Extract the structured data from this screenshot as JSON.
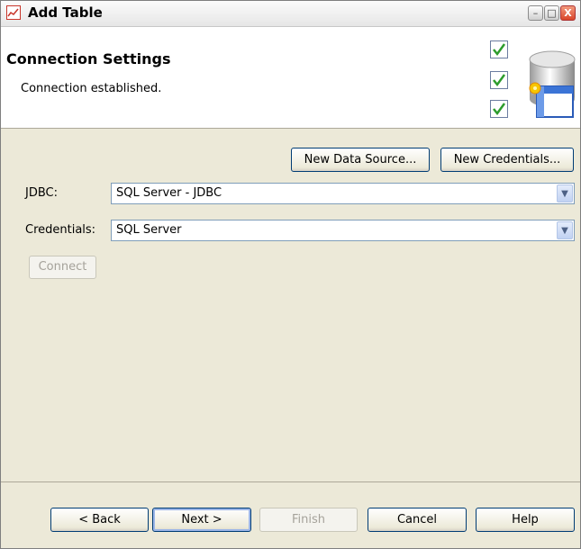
{
  "window": {
    "title": "Add Table",
    "controls": {
      "minimize": "–",
      "maximize": "□",
      "close": "X"
    }
  },
  "header": {
    "title": "Connection Settings",
    "subtitle": "Connection established."
  },
  "toolbar": {
    "new_data_source": "New Data Source...",
    "new_credentials": "New Credentials..."
  },
  "form": {
    "jdbc_label": "JDBC:",
    "jdbc_value": "SQL Server - JDBC",
    "credentials_label": "Credentials:",
    "credentials_value": "SQL Server",
    "connect_label": "Connect"
  },
  "footer": {
    "back": "< Back",
    "next": "Next >",
    "finish": "Finish",
    "cancel": "Cancel",
    "help": "Help"
  },
  "colors": {
    "accent_red": "#c8362b",
    "check_green": "#2d9c2d",
    "button_border": "#003c74",
    "dialog_bg": "#ece9d8"
  }
}
